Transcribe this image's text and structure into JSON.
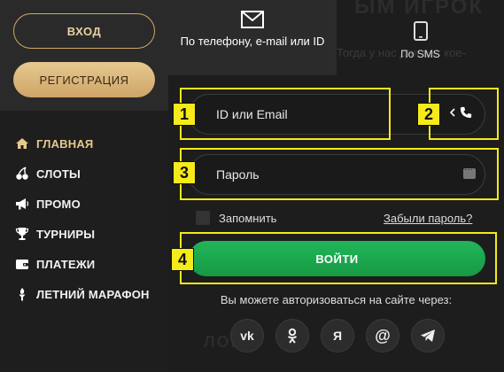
{
  "sidebar": {
    "login_label": "ВХОД",
    "register_label": "РЕГИСТРАЦИЯ",
    "menu": [
      {
        "label": "ГЛАВНАЯ",
        "icon": "home-icon"
      },
      {
        "label": "СЛОТЫ",
        "icon": "cherries-icon"
      },
      {
        "label": "ПРОМО",
        "icon": "megaphone-icon"
      },
      {
        "label": "ТУРНИРЫ",
        "icon": "trophy-icon"
      },
      {
        "label": "ПЛАТЕЖИ",
        "icon": "wallet-icon"
      },
      {
        "label": "ЛЕТНИЙ МАРАФОН",
        "icon": "torch-icon"
      }
    ]
  },
  "tabs": {
    "phone_email_label": "По телефону, e-mail или ID",
    "sms_label": "По SMS"
  },
  "background_text": {
    "top": "ЫМ ИГРОК",
    "mid": "Тогда у нас для вас кое-",
    "bottom": "ЛОВ"
  },
  "form": {
    "id_placeholder": "ID или Email",
    "password_placeholder": "Пароль",
    "remember_label": "Запомнить",
    "forgot_label": "Забыли пароль?",
    "submit_label": "ВОЙТИ",
    "social_text": "Вы можете авторизоваться на сайте через:"
  },
  "socials": [
    {
      "label": "vk",
      "icon": "vk-icon"
    },
    {
      "label": "ok",
      "icon": "odnoklassniki-icon"
    },
    {
      "label": "Я",
      "icon": "yandex-icon"
    },
    {
      "label": "@",
      "icon": "mailru-icon"
    },
    {
      "label": "",
      "icon": "telegram-icon"
    }
  ],
  "annotations": [
    "1",
    "2",
    "3",
    "4"
  ],
  "colors": {
    "accent_gold": "#e6c98f",
    "submit_green": "#1aa84d",
    "highlight_yellow": "#f6ea1a"
  }
}
